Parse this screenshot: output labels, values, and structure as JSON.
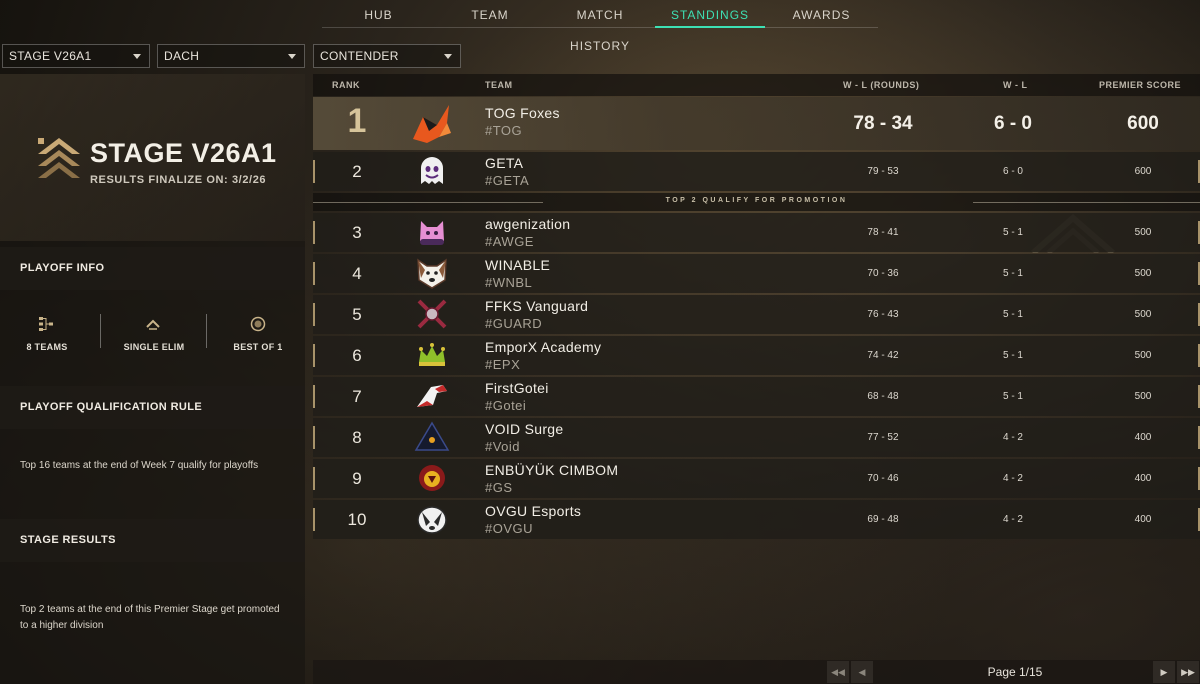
{
  "nav": {
    "tabs": [
      {
        "label": "HUB",
        "active": false
      },
      {
        "label": "TEAM",
        "active": false
      },
      {
        "label": "MATCH HISTORY",
        "active": false
      },
      {
        "label": "STANDINGS",
        "active": true
      },
      {
        "label": "AWARDS",
        "active": false
      }
    ]
  },
  "filters": {
    "stage": "STAGE V26A1",
    "region": "DACH",
    "division": "CONTENDER"
  },
  "stage_card": {
    "title": "STAGE V26A1",
    "subtitle": "RESULTS FINALIZE ON: 3/2/26"
  },
  "playoff_info": {
    "heading": "PLAYOFF INFO",
    "items": [
      {
        "label": "8 TEAMS",
        "icon": "bracket-icon"
      },
      {
        "label": "SINGLE ELIM",
        "icon": "chevron-up-icon"
      },
      {
        "label": "BEST OF 1",
        "icon": "target-icon"
      }
    ]
  },
  "qualification": {
    "heading": "PLAYOFF QUALIFICATION RULE",
    "text": "Top 16 teams at the end of Week 7 qualify for playoffs"
  },
  "stage_results": {
    "heading": "STAGE RESULTS",
    "text": "Top 2 teams at the end of this Premier Stage get promoted to a higher division"
  },
  "table": {
    "headers": {
      "rank": "RANK",
      "team": "TEAM",
      "wl_rounds": "W - L (ROUNDS)",
      "wl": "W - L",
      "score": "PREMIER SCORE"
    },
    "promo_text": "TOP 2 QUALIFY FOR PROMOTION",
    "rows": [
      {
        "rank": "1",
        "name": "TOG Foxes",
        "tag": "#TOG",
        "wl_rounds": "78 - 34",
        "wl": "6 - 0",
        "score": "600",
        "logo": "fox-logo-icon"
      },
      {
        "rank": "2",
        "name": "GETA",
        "tag": "#GETA",
        "wl_rounds": "79 - 53",
        "wl": "6 - 0",
        "score": "600",
        "logo": "ghost-logo-icon"
      },
      {
        "rank": "3",
        "name": "awgenization",
        "tag": "#AWGE",
        "wl_rounds": "78 - 41",
        "wl": "5 - 1",
        "score": "500",
        "logo": "cat-logo-icon"
      },
      {
        "rank": "4",
        "name": "WINABLE",
        "tag": "#WNBL",
        "wl_rounds": "70 - 36",
        "wl": "5 - 1",
        "score": "500",
        "logo": "dog-logo-icon"
      },
      {
        "rank": "5",
        "name": "FFKS Vanguard",
        "tag": "#GUARD",
        "wl_rounds": "76 - 43",
        "wl": "5 - 1",
        "score": "500",
        "logo": "crossed-swords-logo-icon"
      },
      {
        "rank": "6",
        "name": "EmporX Academy",
        "tag": "#EPX",
        "wl_rounds": "74 - 42",
        "wl": "5 - 1",
        "score": "500",
        "logo": "crown-logo-icon"
      },
      {
        "rank": "7",
        "name": "FirstGotei",
        "tag": "#Gotei",
        "wl_rounds": "68 - 48",
        "wl": "5 - 1",
        "score": "500",
        "logo": "bird-logo-icon"
      },
      {
        "rank": "8",
        "name": "VOID Surge",
        "tag": "#Void",
        "wl_rounds": "77 - 52",
        "wl": "4 - 2",
        "score": "400",
        "logo": "triangle-logo-icon"
      },
      {
        "rank": "9",
        "name": "ENBÜYÜK CIMBOM",
        "tag": "#GS",
        "wl_rounds": "70 - 46",
        "wl": "4 - 2",
        "score": "400",
        "logo": "lion-logo-icon"
      },
      {
        "rank": "10",
        "name": "OVGU Esports",
        "tag": "#OVGU",
        "wl_rounds": "69 - 48",
        "wl": "4 - 2",
        "score": "400",
        "logo": "badger-logo-icon"
      }
    ]
  },
  "pagination": {
    "text": "Page 1/15"
  },
  "colors": {
    "accent": "#3de0b4",
    "gold": "#d6c49a"
  }
}
